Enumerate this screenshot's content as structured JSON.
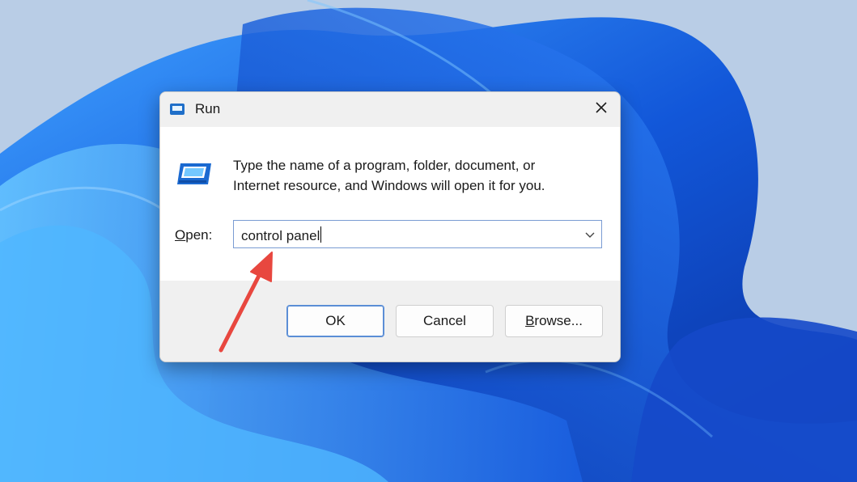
{
  "dialog": {
    "title": "Run",
    "description_line1": "Type the name of a program, folder, document, or",
    "description_line2": "Internet resource, and Windows will open it for you.",
    "open_label_first": "O",
    "open_label_rest": "pen:",
    "open_value": "control panel",
    "buttons": {
      "ok": "OK",
      "cancel": "Cancel",
      "browse_first": "B",
      "browse_rest": "rowse..."
    }
  },
  "icons": {
    "title": "run-icon",
    "close": "close-icon",
    "main": "run-program-icon",
    "dropdown": "chevron-down-icon"
  },
  "annotation": {
    "type": "red-arrow",
    "color": "#e8473f"
  },
  "colors": {
    "accent": "#5b8ed6",
    "wallpaper_blue": "#1e6ae8"
  }
}
